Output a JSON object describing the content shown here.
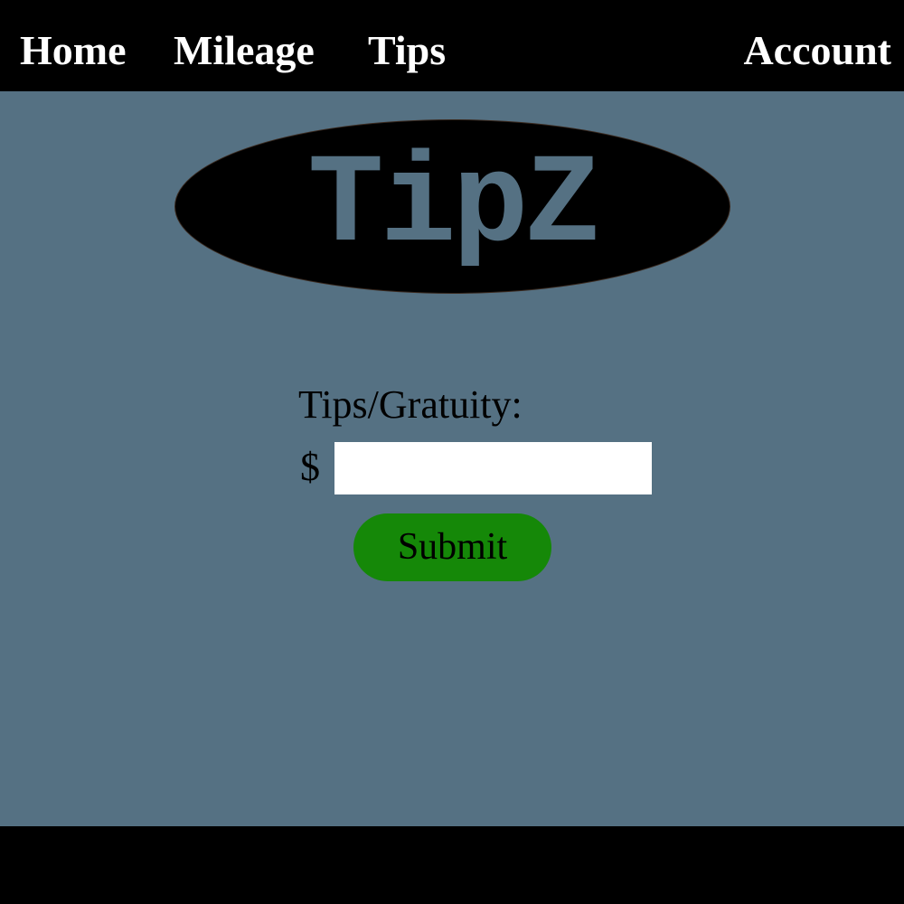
{
  "nav": {
    "home": "Home",
    "mileage": "Mileage",
    "tips": "Tips",
    "account": "Account"
  },
  "logo": {
    "text": "TipZ"
  },
  "form": {
    "label": "Tips/Gratuity:",
    "currency_symbol": "$",
    "input_value": "",
    "submit_label": "Submit"
  },
  "colors": {
    "background": "#557183",
    "nav_background": "#000000",
    "nav_text": "#ffffff",
    "logo_background": "#000000",
    "logo_text": "#557183",
    "submit_button": "#158808"
  }
}
